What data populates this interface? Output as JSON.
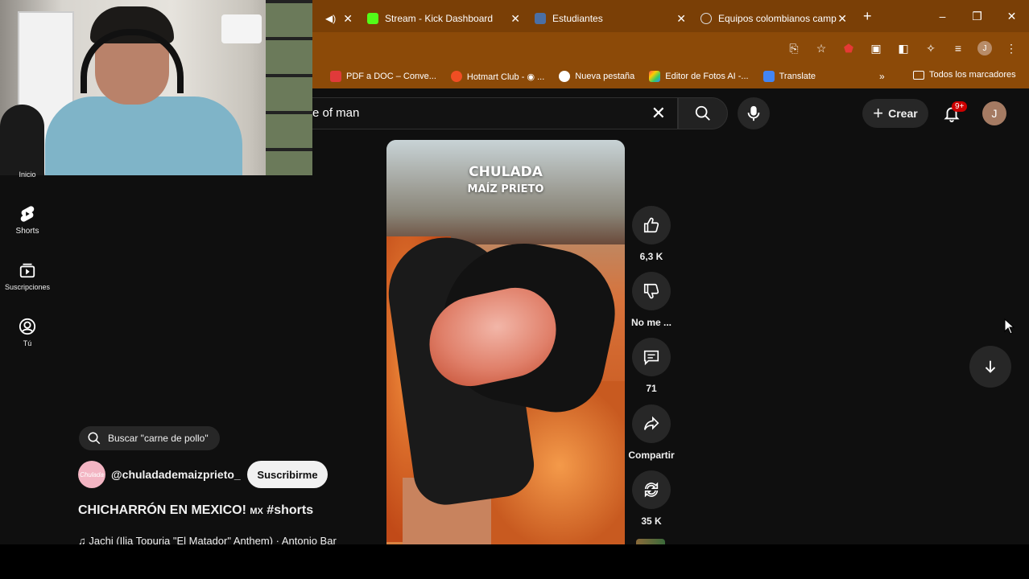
{
  "browser": {
    "tabs": [
      {
        "label": "",
        "active": false,
        "favicon_color": "#7a3f06"
      },
      {
        "label": "Stream - Kick Dashboard",
        "active": false,
        "favicon_color": "#53fc18"
      },
      {
        "label": "Estudiantes",
        "active": false,
        "favicon_color": "#4a6fa5"
      },
      {
        "label": "Equipos colombianos camp",
        "active": false,
        "favicon_color": "#888888"
      }
    ],
    "new_tab": "+",
    "window_controls": [
      "–",
      "❐",
      "✕"
    ],
    "bookmarks": [
      {
        "label": "PDF a DOC – Conve...",
        "icon_color": "#e03a3a"
      },
      {
        "label": "Hotmart Club - ◉ ...",
        "icon_color": "#f04e23"
      },
      {
        "label": "Nueva pestaña",
        "icon_color": "#ffffff"
      },
      {
        "label": "Editor de Fotos AI -...",
        "icon_color": "#7a5cff"
      },
      {
        "label": "Translate",
        "icon_color": "#4285f4"
      }
    ],
    "bookmarks_more": "»",
    "all_bookmarks": "Todos los marcadores",
    "profile_initial": "J"
  },
  "youtube": {
    "search_value": "e of man",
    "create_label": "Crear",
    "notifications_badge": "9+",
    "avatar_initial": "J",
    "sidebar": [
      {
        "label": "Inicio",
        "icon": "home-icon"
      },
      {
        "label": "Shorts",
        "icon": "shorts-icon"
      },
      {
        "label": "Suscripciones",
        "icon": "subscriptions-icon"
      },
      {
        "label": "Tú",
        "icon": "you-icon"
      }
    ],
    "short": {
      "overlay_line1": "CHULADA",
      "overlay_line2": "MAÍZ PRIETO"
    },
    "actions": {
      "like_count": "6,3 K",
      "dislike_label": "No me ...",
      "comment_count": "71",
      "share_label": "Compartir",
      "remix_count": "35 K"
    },
    "search_chip": "Buscar \"carne de pollo\"",
    "channel": {
      "avatar_text": "Chulada",
      "name": "@chuladademaizprieto_",
      "subscribe_label": "Suscribirme"
    },
    "video_title": "CHICHARRÓN EN MEXICO!",
    "video_title_flag": "MX",
    "video_title_tag": "#shorts",
    "song": "♫ Jachi (Ilia Topuria \"El Matador\" Anthem) · Antonio Bar"
  }
}
